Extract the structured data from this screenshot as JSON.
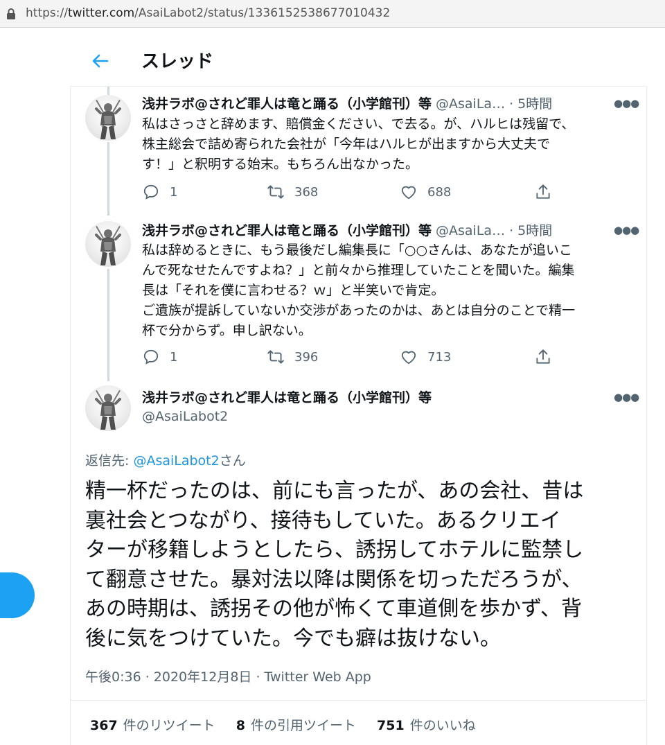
{
  "browser": {
    "url_prefix": "https://",
    "url_host": "twitter.com",
    "url_path": "/AsaiLabot2/status/1336152538677010432"
  },
  "header": {
    "title": "スレッド"
  },
  "tweets": [
    {
      "name": "浅井ラボ@されど罪人は竜と踊る（小学館刊）等",
      "handle": "@AsaiLa…",
      "dot": "·",
      "time": "5時間",
      "text": "私はさっさと辞めます、賠償金ください、で去る。が、ハルヒは残留で、\n株主総会で詰め寄られた会社が「今年はハルヒが出ますから大丈夫で\nす！」と釈明する始末。もちろん出なかった。",
      "replies": "1",
      "retweets": "368",
      "likes": "688"
    },
    {
      "name": "浅井ラボ@されど罪人は竜と踊る（小学館刊）等",
      "handle": "@AsaiLa…",
      "dot": "·",
      "time": "5時間",
      "text": "私は辞めるときに、もう最後だし編集長に「○○さんは、あなたが追いこ\nんで死なせたんですよね？」と前々から推理していたことを聞いた。編集\n長は「それを僕に言わせる？ｗ」と半笑いで肯定。\nご遺族が提訴していないか交渉があったのかは、あとは自分のことで精一\n杯で分からず。申し訳ない。",
      "replies": "1",
      "retweets": "396",
      "likes": "713"
    }
  ],
  "main_tweet": {
    "name": "浅井ラボ@されど罪人は竜と踊る（小学館刊）等",
    "handle": "@AsaiLabot2",
    "reply_prefix": "返信先: ",
    "reply_handle": "@AsaiLabot2",
    "reply_suffix": "さん",
    "text": "精一杯だったのは、前にも言ったが、あの会社、昔は\n裏社会とつながり、接待もしていた。あるクリエイ\nターが移籍しようとしたら、誘拐してホテルに監禁し\nて翻意させた。暴対法以降は関係を切っただろうが、\nあの時期は、誘拐その他が怖くて車道側を歩かず、背\n後に気をつけていた。今でも癖は抜けない。",
    "time": "午後0:36",
    "sep": " · ",
    "date": "2020年12月8日",
    "app": "Twitter Web App",
    "stats": {
      "retweets_count": "367",
      "retweets_label": "件のリツイート",
      "quotes_count": "8",
      "quotes_label": "件の引用ツイート",
      "likes_count": "751",
      "likes_label": "件のいいね"
    }
  },
  "colors": {
    "accent": "#1da1f2",
    "link": "#1b95e0",
    "secondary_text": "#536471",
    "border": "#e6ecf0"
  },
  "icons": {
    "back": "arrow-left-icon",
    "reply": "speech-bubble-icon",
    "retweet": "retweet-arrows-icon",
    "like": "heart-icon",
    "share": "share-upload-icon",
    "more": "ellipsis-icon",
    "lock": "lock-icon"
  }
}
